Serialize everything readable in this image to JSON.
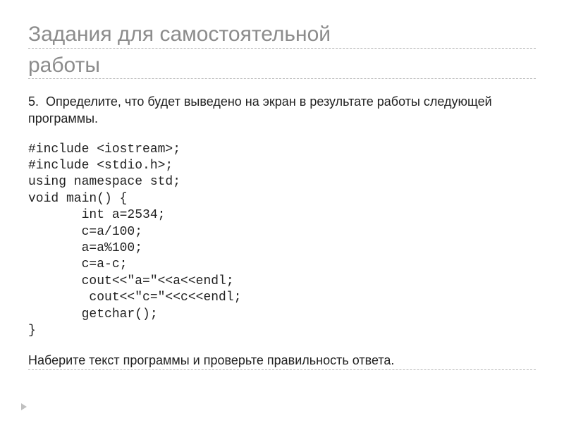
{
  "title": {
    "line1": "Задания для самостоятельной",
    "line2": "работы"
  },
  "task": {
    "number": "5.",
    "prompt": "Определите, что будет выведено на экран в результате работы следующей программы."
  },
  "code": "#include <iostream>;\n#include <stdio.h>;\nusing namespace std;\nvoid main() {\n       int a=2534;\n       c=a/100;\n       a=a%100;\n       c=a-c;\n       cout<<\"a=\"<<a<<endl;\n        cout<<\"c=\"<<c<<endl;\n       getchar();\n}",
  "footer": "Наберите текст программы и проверьте правильность ответа."
}
